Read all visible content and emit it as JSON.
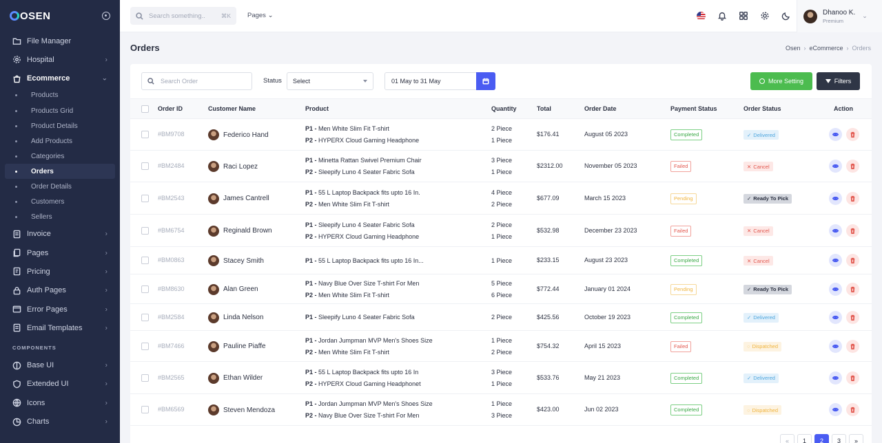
{
  "brand": {
    "name": "OSEN"
  },
  "sidebar": {
    "items_top": [
      {
        "label": "File Manager",
        "icon": "folder-icon",
        "chevron": false
      },
      {
        "label": "Hospital",
        "icon": "gear-icon",
        "chevron": true
      },
      {
        "label": "Ecommerce",
        "icon": "shopping-bag-icon",
        "chevron": true,
        "open": true
      }
    ],
    "ecommerce_sub": [
      "Products",
      "Products Grid",
      "Product Details",
      "Add Products",
      "Categories",
      "Orders",
      "Order Details",
      "Customers",
      "Sellers"
    ],
    "active_sub": "Orders",
    "items_mid": [
      {
        "label": "Invoice",
        "icon": "invoice-icon"
      },
      {
        "label": "Pages",
        "icon": "pages-icon"
      },
      {
        "label": "Pricing",
        "icon": "pricing-icon"
      },
      {
        "label": "Auth Pages",
        "icon": "lock-icon"
      },
      {
        "label": "Error Pages",
        "icon": "error-icon"
      },
      {
        "label": "Email Templates",
        "icon": "email-icon"
      }
    ],
    "section_label": "COMPONENTS",
    "items_bottom": [
      {
        "label": "Base UI",
        "icon": "base-ui-icon"
      },
      {
        "label": "Extended UI",
        "icon": "shield-icon"
      },
      {
        "label": "Icons",
        "icon": "globe-icon"
      },
      {
        "label": "Charts",
        "icon": "chart-icon"
      }
    ]
  },
  "topbar": {
    "search_placeholder": "Search something..",
    "shortcut": "⌘K",
    "pages_menu": "Pages",
    "user_name": "Dhanoo K.",
    "user_role": "Premium"
  },
  "page": {
    "title": "Orders",
    "breadcrumb": [
      "Osen",
      "eCommerce",
      "Orders"
    ]
  },
  "filters": {
    "search_placeholder": "Search Order",
    "status_label": "Status",
    "status_value": "Select",
    "date_range": "01 May to 31 May",
    "more_setting": "More Setting",
    "filters_label": "Filters"
  },
  "table": {
    "headers": [
      "Order ID",
      "Customer Name",
      "Product",
      "Quantity",
      "Total",
      "Order Date",
      "Payment Status",
      "Order Status",
      "Action"
    ],
    "rows": [
      {
        "id": "#BM9708",
        "customer": "Federico Hand",
        "products": [
          {
            "tag": "P1 -",
            "name": "Men White Slim Fit T-shirt"
          },
          {
            "tag": "P2 -",
            "name": "HYPERX Cloud Gaming Headphone"
          }
        ],
        "qty": [
          "2 Piece",
          "1 Piece"
        ],
        "total": "$176.41",
        "date": "August 05 2023",
        "payment": "Completed",
        "status": "Delivered"
      },
      {
        "id": "#BM2484",
        "customer": "Raci Lopez",
        "products": [
          {
            "tag": "P1 -",
            "name": "Minetta Rattan Swivel Premium Chair"
          },
          {
            "tag": "P2 -",
            "name": "Sleepify Luno 4 Seater Fabric Sofa"
          }
        ],
        "qty": [
          "3 Piece",
          "1 Piece"
        ],
        "total": "$2312.00",
        "date": "November 05 2023",
        "payment": "Failed",
        "status": "Cancel"
      },
      {
        "id": "#BM2543",
        "customer": "James Cantrell",
        "products": [
          {
            "tag": "P1 -",
            "name": "55 L Laptop Backpack fits upto 16 In."
          },
          {
            "tag": "P2 -",
            "name": "Men White Slim Fit T-shirt"
          }
        ],
        "qty": [
          "4 Piece",
          "2 Piece"
        ],
        "total": "$677.09",
        "date": "March 15 2023",
        "payment": "Pending",
        "status": "Ready To Pick"
      },
      {
        "id": "#BM6754",
        "customer": "Reginald Brown",
        "products": [
          {
            "tag": "P1 -",
            "name": "Sleepify Luno 4 Seater Fabric Sofa"
          },
          {
            "tag": "P2 -",
            "name": "HYPERX Cloud Gaming Headphone"
          }
        ],
        "qty": [
          "2 Piece",
          "1 Piece"
        ],
        "total": "$532.98",
        "date": "December 23 2023",
        "payment": "Failed",
        "status": "Cancel"
      },
      {
        "id": "#BM0863",
        "customer": "Stacey Smith",
        "products": [
          {
            "tag": "P1 -",
            "name": "55 L Laptop Backpack fits upto 16 In..."
          }
        ],
        "qty": [
          "1 Piece"
        ],
        "total": "$233.15",
        "date": "August 23 2023",
        "payment": "Completed",
        "status": "Cancel"
      },
      {
        "id": "#BM8630",
        "customer": "Alan Green",
        "products": [
          {
            "tag": "P1 -",
            "name": "Navy Blue Over Size T-shirt For Men"
          },
          {
            "tag": "P2 -",
            "name": "Men White Slim Fit T-shirt"
          }
        ],
        "qty": [
          "5 Piece",
          "6 Piece"
        ],
        "total": "$772.44",
        "date": "January 01 2024",
        "payment": "Pending",
        "status": "Ready To Pick"
      },
      {
        "id": "#BM2584",
        "customer": "Linda Nelson",
        "products": [
          {
            "tag": "P1 -",
            "name": "Sleepify Luno 4 Seater Fabric Sofa"
          }
        ],
        "qty": [
          "2 Piece"
        ],
        "total": "$425.56",
        "date": "October 19 2023",
        "payment": "Completed",
        "status": "Delivered"
      },
      {
        "id": "#BM7466",
        "customer": "Pauline Piaffe",
        "products": [
          {
            "tag": "P1 -",
            "name": "Jordan Jumpman MVP Men's Shoes Size"
          },
          {
            "tag": "P2 -",
            "name": "Men White Slim Fit T-shirt"
          }
        ],
        "qty": [
          "1 Piece",
          "2 Piece"
        ],
        "total": "$754.32",
        "date": "April 15 2023",
        "payment": "Failed",
        "status": "Dispatched"
      },
      {
        "id": "#BM2565",
        "customer": "Ethan Wilder",
        "products": [
          {
            "tag": "P1 -",
            "name": "55 L Laptop Backpack fits upto 16 In"
          },
          {
            "tag": "P2 -",
            "name": "HYPERX Cloud Gaming Headphonet"
          }
        ],
        "qty": [
          "3 Piece",
          "1 Piece"
        ],
        "total": "$533.76",
        "date": "May 21 2023",
        "payment": "Completed",
        "status": "Delivered"
      },
      {
        "id": "#BM6569",
        "customer": "Steven Mendoza",
        "products": [
          {
            "tag": "P1 -",
            "name": "Jordan Jumpman MVP Men's Shoes Size"
          },
          {
            "tag": "P2 -",
            "name": "Navy Blue Over Size T-shirt For Men"
          }
        ],
        "qty": [
          "1 Piece",
          "3 Piece"
        ],
        "total": "$423.00",
        "date": "Jun 02 2023",
        "payment": "Completed",
        "status": "Dispatched"
      }
    ]
  },
  "pagination": {
    "pages": [
      "«",
      "1",
      "2",
      "3",
      "»"
    ],
    "active": "2"
  },
  "colors": {
    "sidebar_bg": "#232b45",
    "accent": "#4a5cf2",
    "success": "#4cbc4f",
    "danger": "#e2584f",
    "warning": "#f0b43d",
    "info": "#4fa6de"
  }
}
